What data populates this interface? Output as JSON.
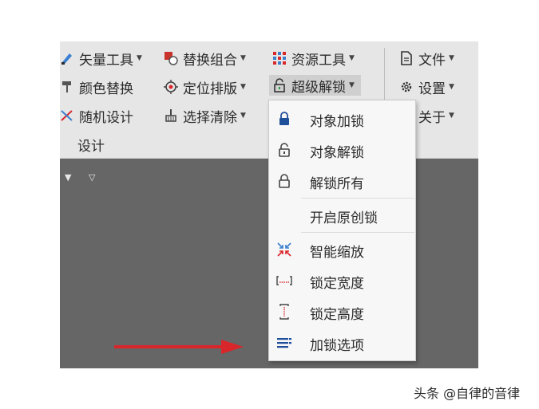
{
  "ribbon": {
    "col1": [
      {
        "label": "矢量工具",
        "icon": "vector-tool-icon"
      },
      {
        "label": "颜色替换",
        "icon": "paint-roller-icon"
      },
      {
        "label": "随机设计",
        "icon": "shuffle-icon"
      }
    ],
    "col2": [
      {
        "label": "替换组合",
        "icon": "replace-group-icon"
      },
      {
        "label": "定位排版",
        "icon": "target-icon"
      },
      {
        "label": "选择清除",
        "icon": "broom-icon"
      }
    ],
    "col3": [
      {
        "label": "资源工具",
        "icon": "resource-grid-icon"
      },
      {
        "label": "超级解锁",
        "icon": "unlock-icon"
      }
    ],
    "col4": [
      {
        "label": "文件",
        "icon": "file-icon"
      },
      {
        "label": "设置",
        "icon": "gear-icon"
      },
      {
        "label": "关于",
        "icon": "info-icon"
      }
    ],
    "group_label": "设计"
  },
  "menu": {
    "items": [
      {
        "label": "对象加锁",
        "icon": "lock-closed-icon"
      },
      {
        "label": "对象解锁",
        "icon": "lock-open-icon"
      },
      {
        "label": "解锁所有",
        "icon": "unlock-all-icon"
      },
      {
        "label": "开启原创锁",
        "icon": ""
      },
      {
        "label": "智能缩放",
        "icon": "smart-scale-icon"
      },
      {
        "label": "锁定宽度",
        "icon": "lock-width-icon"
      },
      {
        "label": "锁定高度",
        "icon": "lock-height-icon"
      },
      {
        "label": "加锁选项",
        "icon": "list-options-icon"
      }
    ]
  },
  "watermark": "头条 @自律的音律",
  "colors": {
    "arrow": "#d9262b",
    "accent_blue": "#1f4f99",
    "canvas": "#666666"
  }
}
